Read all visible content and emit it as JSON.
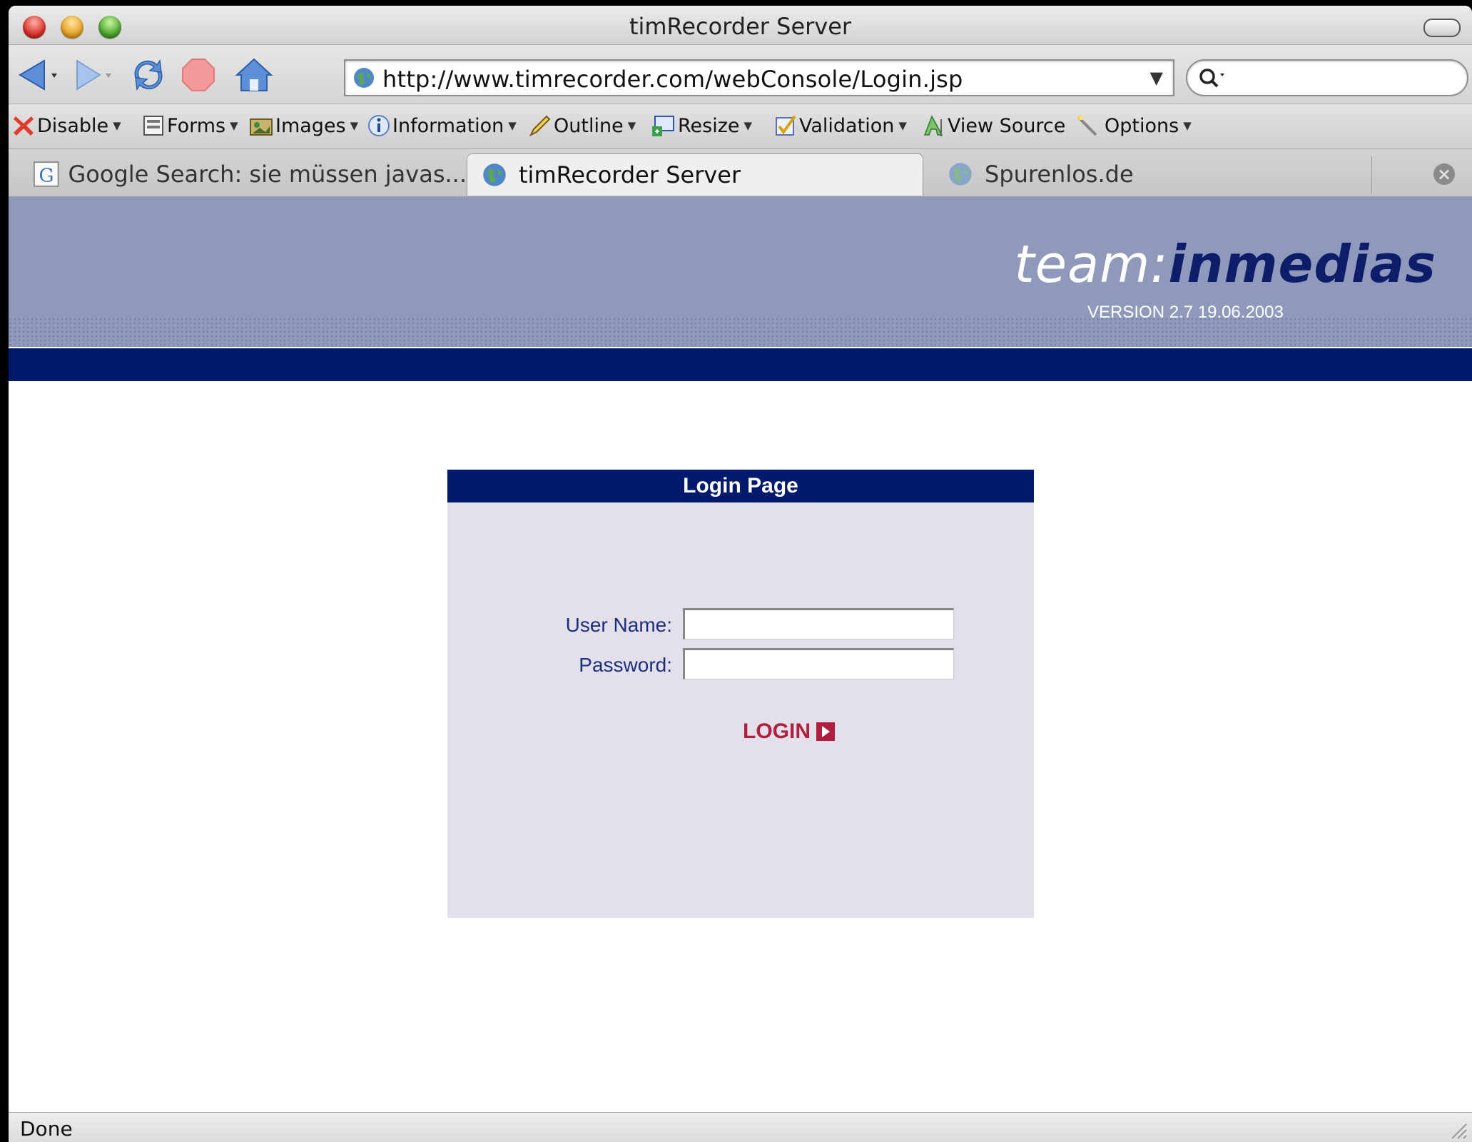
{
  "window": {
    "title": "timRecorder Server"
  },
  "nav": {
    "url": "http://www.timrecorder.com/webConsole/Login.jsp",
    "search_value": ""
  },
  "devtoolbar": {
    "items": [
      {
        "label": "Disable",
        "icon": "disable-icon"
      },
      {
        "label": "Forms",
        "icon": "forms-icon"
      },
      {
        "label": "Images",
        "icon": "images-icon"
      },
      {
        "label": "Information",
        "icon": "information-icon"
      },
      {
        "label": "Outline",
        "icon": "outline-icon"
      },
      {
        "label": "Resize",
        "icon": "resize-icon"
      },
      {
        "label": "Validation",
        "icon": "validation-icon"
      },
      {
        "label": "View Source",
        "icon": "view-source-icon"
      },
      {
        "label": "Options",
        "icon": "options-icon"
      }
    ]
  },
  "tabs": [
    {
      "label": "Google Search: sie müssen javas...",
      "icon": "google-icon",
      "active": false
    },
    {
      "label": "timRecorder Server",
      "icon": "globe-icon",
      "active": true
    },
    {
      "label": "Spurenlos.de",
      "icon": "globe-icon",
      "active": false
    }
  ],
  "banner": {
    "brand_part1": "team:",
    "brand_part2": "inmedias",
    "version": "VERSION 2.7 19.06.2003"
  },
  "login": {
    "heading": "Login Page",
    "username_label": "User Name:",
    "username_value": "",
    "password_label": "Password:",
    "password_value": "",
    "button_label": "LOGIN"
  },
  "status": {
    "text": "Done"
  },
  "colors": {
    "banner_bg": "#8f99bb",
    "navy": "#011a6e",
    "login_panel": "#e3e0eb",
    "login_button": "#b0203e",
    "label_text": "#1b2f7b"
  }
}
